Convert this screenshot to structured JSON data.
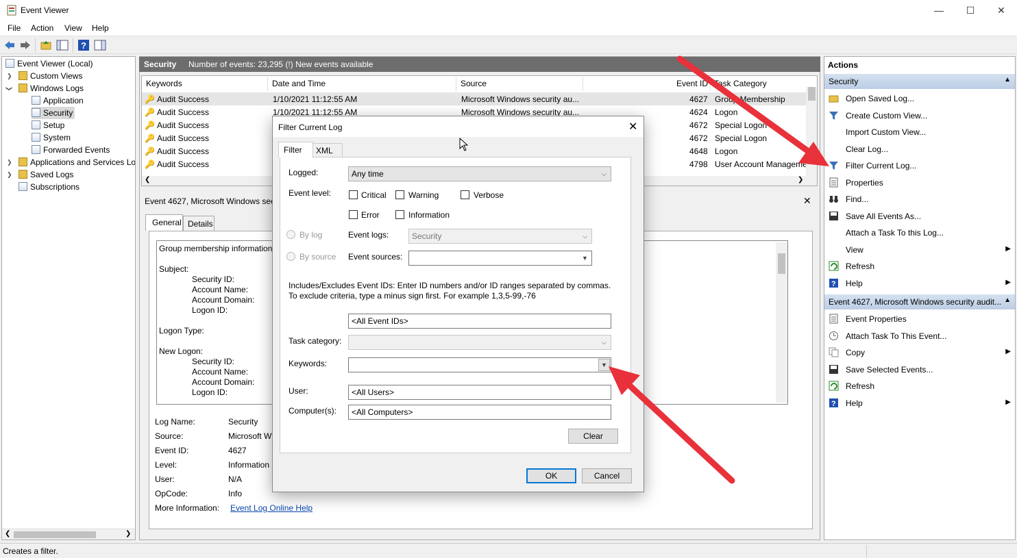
{
  "window": {
    "title": "Event Viewer",
    "min": "—",
    "max": "☐",
    "close": "✕"
  },
  "menu": [
    "File",
    "Action",
    "View",
    "Help"
  ],
  "tree": {
    "root": "Event Viewer (Local)",
    "custom_views": "Custom Views",
    "windows_logs": "Windows Logs",
    "application": "Application",
    "security": "Security",
    "setup": "Setup",
    "system": "System",
    "forwarded": "Forwarded Events",
    "apps_services": "Applications and Services Lo",
    "saved_logs": "Saved Logs",
    "subscriptions": "Subscriptions"
  },
  "log_header": {
    "name": "Security",
    "info": "Number of events: 23,295 (!) New events available"
  },
  "grid": {
    "columns": [
      "Keywords",
      "Date and Time",
      "Source",
      "Event ID",
      "Task Category"
    ],
    "rows": [
      {
        "kw": "Audit Success",
        "dt": "1/10/2021 11:12:55 AM",
        "src": "Microsoft Windows security au...",
        "id": "4627",
        "cat": "Group Membership"
      },
      {
        "kw": "Audit Success",
        "dt": "1/10/2021 11:12:55 AM",
        "src": "Microsoft Windows security au...",
        "id": "4624",
        "cat": "Logon"
      },
      {
        "kw": "Audit Success",
        "dt": "",
        "src": "",
        "id": "4672",
        "cat": "Special Logon"
      },
      {
        "kw": "Audit Success",
        "dt": "",
        "src": "",
        "id": "4672",
        "cat": "Special Logon"
      },
      {
        "kw": "Audit Success",
        "dt": "",
        "src": "",
        "id": "4648",
        "cat": "Logon"
      },
      {
        "kw": "Audit Success",
        "dt": "",
        "src": "",
        "id": "4798",
        "cat": "User Account Manageme"
      }
    ]
  },
  "detail": {
    "title": "Event 4627, Microsoft Windows sec",
    "tab_general": "General",
    "tab_details": "Details",
    "desc_first": "Group membership information",
    "subject": "Subject:",
    "security_id": "Security ID:",
    "account_name": "Account Name:",
    "account_domain": "Account Domain:",
    "logon_id": "Logon ID:",
    "logon_type": "Logon Type:",
    "new_logon": "New Logon:",
    "fields": {
      "log_name_l": "Log Name:",
      "log_name_v": "Security",
      "source_l": "Source:",
      "source_v": "Microsoft W",
      "event_id_l": "Event ID:",
      "event_id_v": "4627",
      "level_l": "Level:",
      "level_v": "Information",
      "user_l": "User:",
      "user_v": "N/A",
      "opcode_l": "OpCode:",
      "opcode_v": "Info",
      "more_l": "More Information:",
      "more_v": "Event Log Online Help"
    }
  },
  "actions": {
    "title": "Actions",
    "section1": "Security",
    "items1": [
      {
        "label": "Open Saved Log...",
        "icon": "folder-icon"
      },
      {
        "label": "Create Custom View...",
        "icon": "filter-icon"
      },
      {
        "label": "Import Custom View...",
        "icon": ""
      },
      {
        "label": "Clear Log...",
        "icon": ""
      },
      {
        "label": "Filter Current Log...",
        "icon": "filter-icon"
      },
      {
        "label": "Properties",
        "icon": "properties-icon"
      },
      {
        "label": "Find...",
        "icon": "binoculars-icon"
      },
      {
        "label": "Save All Events As...",
        "icon": "save-icon"
      },
      {
        "label": "Attach a Task To this Log...",
        "icon": ""
      },
      {
        "label": "View",
        "icon": "",
        "arrow": true
      },
      {
        "label": "Refresh",
        "icon": "refresh-icon"
      },
      {
        "label": "Help",
        "icon": "help-icon",
        "arrow": true
      }
    ],
    "section2": "Event 4627, Microsoft Windows security audit...",
    "items2": [
      {
        "label": "Event Properties",
        "icon": "properties-icon"
      },
      {
        "label": "Attach Task To This Event...",
        "icon": "task-icon"
      },
      {
        "label": "Copy",
        "icon": "copy-icon",
        "arrow": true
      },
      {
        "label": "Save Selected Events...",
        "icon": "save-icon"
      },
      {
        "label": "Refresh",
        "icon": "refresh-icon"
      },
      {
        "label": "Help",
        "icon": "help-icon",
        "arrow": true
      }
    ]
  },
  "status": "Creates a filter.",
  "dialog": {
    "title": "Filter Current Log",
    "tab_filter": "Filter",
    "tab_xml": "XML",
    "logged_l": "Logged:",
    "logged_v": "Any time",
    "level_l": "Event level:",
    "critical": "Critical",
    "warning": "Warning",
    "verbose": "Verbose",
    "error": "Error",
    "information": "Information",
    "by_log": "By log",
    "by_source": "By source",
    "event_logs_l": "Event logs:",
    "event_logs_v": "Security",
    "event_sources_l": "Event sources:",
    "event_sources_v": "",
    "includes_text": "Includes/Excludes Event IDs: Enter ID numbers and/or ID ranges separated by commas. To exclude criteria, type a minus sign first. For example 1,3,5-99,-76",
    "event_ids_v": "<All Event IDs>",
    "task_cat_l": "Task category:",
    "keywords_l": "Keywords:",
    "user_l": "User:",
    "user_v": "<All Users>",
    "computer_l": "Computer(s):",
    "computer_v": "<All Computers>",
    "clear": "Clear",
    "ok": "OK",
    "cancel": "Cancel"
  },
  "colors": {
    "accent": "#0078d7",
    "arrow": "#e8313a",
    "header_dark": "#6d6d6d",
    "section_blue": "#c7d7ec"
  }
}
